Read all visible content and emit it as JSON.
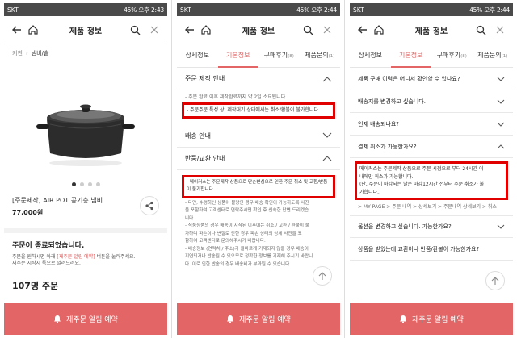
{
  "status_bar": {
    "carrier": "SKT",
    "phone1_time": "45% 오후 2:43",
    "phone2_time": "45% 오후 2:44",
    "phone3_time": "45% 오후 2:44"
  },
  "header": {
    "title": "제품 정보"
  },
  "phone1": {
    "breadcrumb": [
      "키친",
      "냄비/솥"
    ],
    "product_name": "[주문제작] AIR POT 공기층 냄비",
    "product_price": "77,000원",
    "order_end_title": "주문이 종료되었습니다.",
    "order_end_desc_1": "주문을 원하시면 아래",
    "order_end_desc_hl": "[재주문 알림 예약]",
    "order_end_desc_2": "버튼을 눌러주세요.",
    "order_end_desc_3": "재주문 시작시 톡으로 알려드려요.",
    "order_count": "107명 주문"
  },
  "tabs": [
    {
      "label": "상세정보",
      "count": ""
    },
    {
      "label": "기본정보",
      "count": ""
    },
    {
      "label": "구매후기",
      "count": "(8)"
    },
    {
      "label": "제품문의",
      "count": "(1)"
    }
  ],
  "phone2": {
    "section1_title": "주문 제작 안내",
    "section1_line1": "- 주문 완료 이후 제작완료까지 약 2일 소요됩니다.",
    "section1_highlight": "- 주문주문 특성 상, 제작대기 상태에서는 취소/환불이 불가합니다.",
    "section2_title": "배송 안내",
    "section3_title": "반품/교환 안내",
    "section3_highlight": "- 메이커스는 주문제작 상품으로 단순변심으로 인한 주문 취소 및 교환/반품이 불가합니다.",
    "section3_lines": [
      "- 다만, 수령하신 상품이 불량인 경우 배송 확인이 가능하도록 사진",
      "을 포함하여 고객센터로 연락주시면 확인 후 신속한 답변 드리겠습",
      "니다.",
      "- 식품상품의 경우 배송이 시작된 이후에는 취소 / 교환 / 환불이 불",
      "가하며 파손이나 변질로 인한 경우 파손 상태의 상세 사진을 포",
      "함하여 고객센터로 문의해주시기 바랍니다.",
      "- 배송정보 (연락처 / 주소)가 올바르게 기재되지 않을 경우 배송이",
      "지연되거나 반송될 수 있으므로 정확한 정보를 기재해 주시기 바랍니",
      "다. 이로 인한 반송의 경우 배송비가 부과될 수 있습니다."
    ]
  },
  "phone3": {
    "faq_before": [
      "제품 구매 이력은 어디서 확인할 수 있나요?",
      "배송지를 변경하고 싶습니다.",
      "언제 배송되나요?",
      "결제 취소가 가능한가요?"
    ],
    "answer_line1": "메이커스는 주문제작 상품으로 주문 시점으로 부터 24시간 이",
    "answer_line2": "내에만 취소가 가능합니다.",
    "answer_line3": "(단, 주문이 마감되는 날은 마감12시간 전부터 주문 취소가 불",
    "answer_line4": "가합니다.)",
    "answer_path": "> MY PAGE > 주문 내역 > 상세보기 > 주문내역 상세보기 > 취소",
    "faq_after": [
      "옵션을 변경하고 싶습니다. 가능한가요?",
      "상품을 받았는데 교환이나 반품/환불이 가능한가요?"
    ]
  },
  "bottom_button": {
    "label": "재주문 알림 예약"
  },
  "colors": {
    "accent": "#e36565",
    "highlight_border": "#e00000"
  }
}
